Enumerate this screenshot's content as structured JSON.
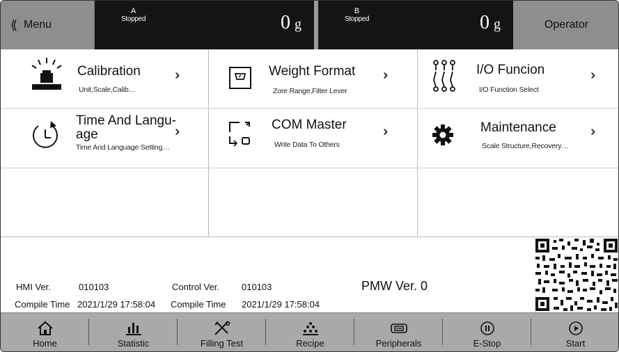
{
  "header": {
    "menu_label": "Menu",
    "menu_chevron": "⟪",
    "scale_a": {
      "name": "A",
      "status": "Stopped",
      "weight": "0",
      "unit": "g"
    },
    "scale_b": {
      "name": "B",
      "status": "Stopped",
      "weight": "0",
      "unit": "g"
    },
    "operator_label": "Operator"
  },
  "tiles": [
    {
      "title": "Calibration",
      "sub": "Unit,Scale,Calib…",
      "icon": "weight-calibration-icon"
    },
    {
      "title": "Weight Format",
      "sub": "Zore Range,Filter Lever",
      "icon": "scale-display-icon"
    },
    {
      "title": "I/O  Funcion",
      "sub": "I/O Function Select",
      "icon": "io-pins-icon"
    },
    {
      "title_line1": "Time And Langu-",
      "title_line2": "age",
      "sub": "Time And Language Setting…",
      "icon": "timer-icon"
    },
    {
      "title": "COM Master",
      "sub": "Write Data To Others",
      "icon": "com-transfer-icon"
    },
    {
      "title": "Maintenance",
      "sub": "Scale Structure,Recovery…",
      "icon": "gear-icon"
    }
  ],
  "arrow_glyph": "»",
  "info": {
    "hmi_label": "HMI Ver.",
    "hmi_value": "010103",
    "control_label": "Control Ver.",
    "control_value": "010103",
    "compile_label_1": "Compile Time",
    "compile_value_1": "2021/1/29 17:58:04",
    "compile_label_2": "Compile Time",
    "compile_value_2": "2021/1/29 17:58:04",
    "pmw": "PMW Ver. 0"
  },
  "nav": [
    {
      "label": "Home",
      "icon": "home-icon"
    },
    {
      "label": "Statistic",
      "icon": "bar-chart-icon"
    },
    {
      "label": "Filling Test",
      "icon": "tools-icon"
    },
    {
      "label": "Recipe",
      "icon": "recipe-dots-icon"
    },
    {
      "label": "Peripherals",
      "icon": "peripheral-icon"
    },
    {
      "label": "E-Stop",
      "icon": "pause-circle-icon"
    },
    {
      "label": "Start",
      "icon": "play-circle-icon"
    }
  ],
  "colors": {
    "header_dark": "#141414",
    "header_gray": "#8e8e8e",
    "nav_gray": "#a9a9a9"
  }
}
